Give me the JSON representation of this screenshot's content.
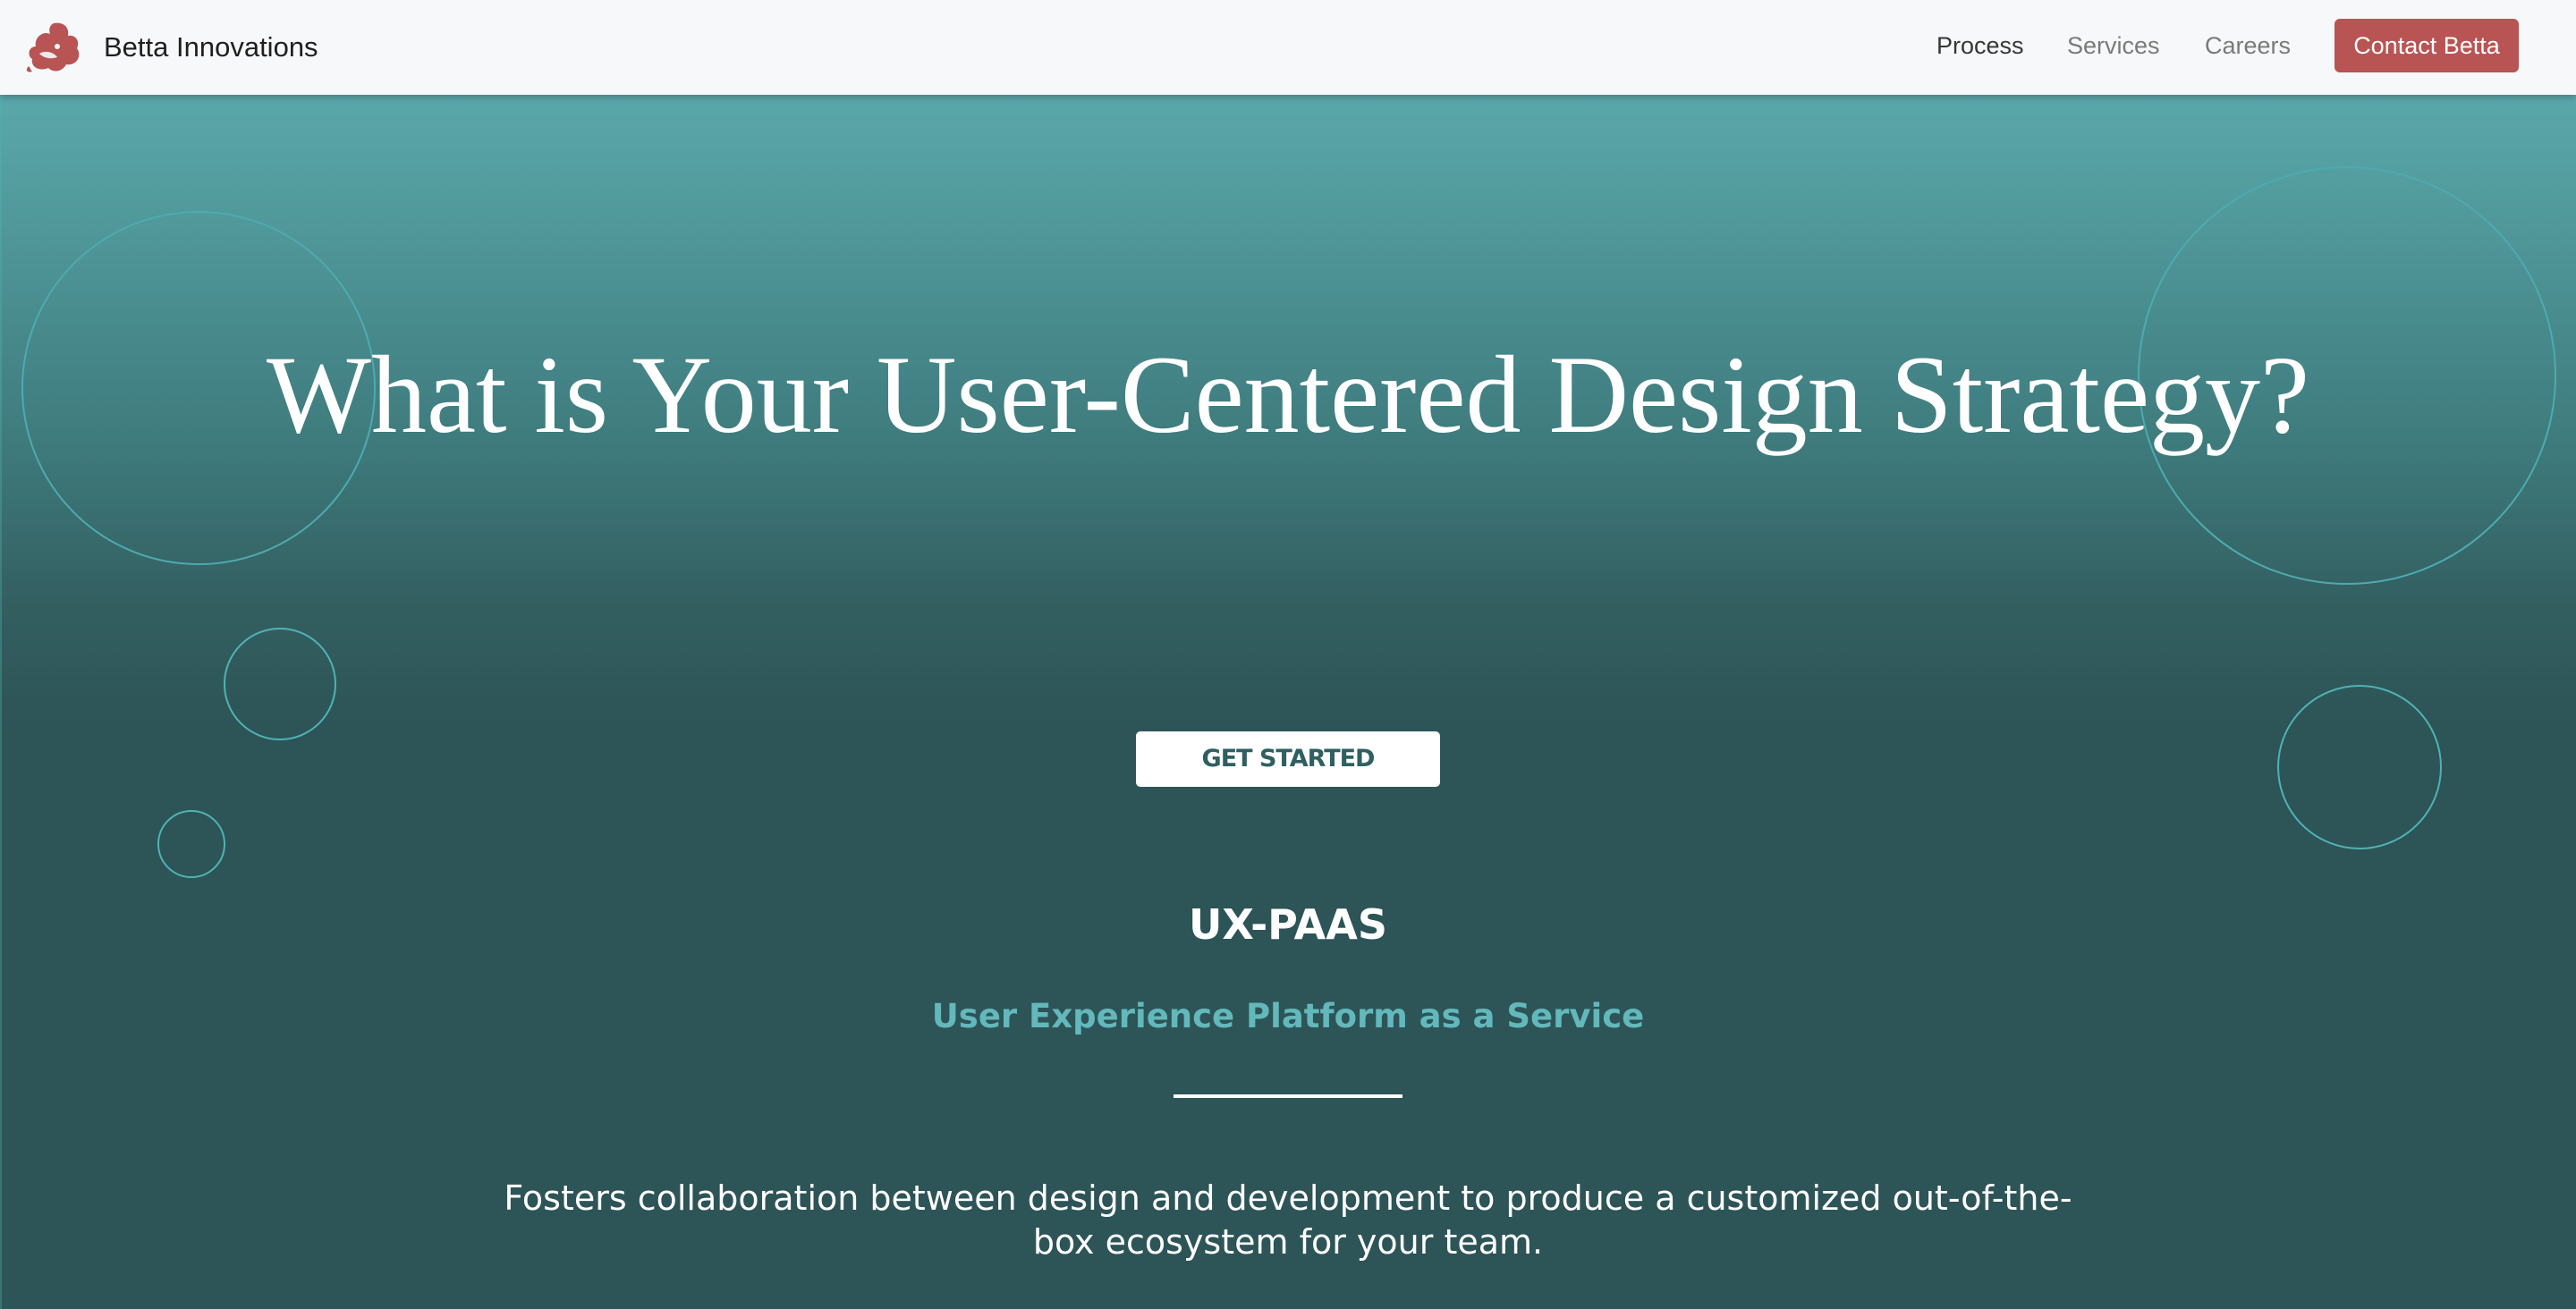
{
  "brand": {
    "name": "Betta Innovations",
    "logo_icon": "betta-fish-logo",
    "logo_color": "#b85454"
  },
  "nav": {
    "links": [
      {
        "label": "Process",
        "active": true
      },
      {
        "label": "Services",
        "active": false
      },
      {
        "label": "Careers",
        "active": false
      }
    ],
    "contact_button": "Contact Betta"
  },
  "hero": {
    "title": "What is Your User-Centered Design Strategy?",
    "cta": "GET STARTED",
    "product_name": "UX-PAAS",
    "product_tagline": "User Experience Platform as a Service",
    "description": "Fosters collaboration between design and development to produce a customized out-of-the-box ecosystem for your team."
  },
  "colors": {
    "accent": "#b85454",
    "hero_top": "#5aa8ab",
    "hero_bottom": "#2d5457",
    "tagline": "#63b8bb",
    "circle_outline": "#4fb3b5"
  }
}
